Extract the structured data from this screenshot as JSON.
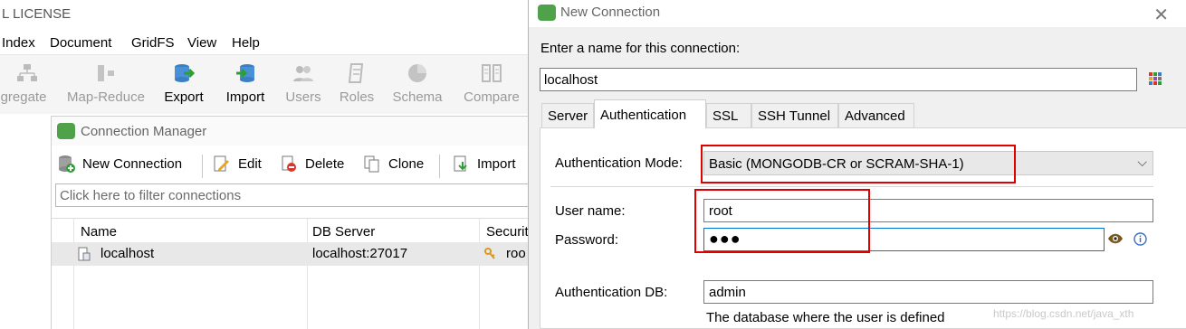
{
  "main_window": {
    "title": "L LICENSE",
    "menu": [
      "Index",
      "Document",
      "GridFS",
      "View",
      "Help"
    ],
    "toolbar": [
      {
        "label": "gregate",
        "icon": "aggregate-icon",
        "enabled": false
      },
      {
        "label": "Map-Reduce",
        "icon": "map-reduce-icon",
        "enabled": false
      },
      {
        "label": "Export",
        "icon": "export-icon",
        "enabled": true
      },
      {
        "label": "Import",
        "icon": "import-icon",
        "enabled": true
      },
      {
        "label": "Users",
        "icon": "users-icon",
        "enabled": false
      },
      {
        "label": "Roles",
        "icon": "roles-icon",
        "enabled": false
      },
      {
        "label": "Schema",
        "icon": "schema-icon",
        "enabled": false
      },
      {
        "label": "Compare",
        "icon": "compare-icon",
        "enabled": false
      }
    ]
  },
  "connection_manager": {
    "title": "Connection Manager",
    "toolbar": {
      "new_connection": "New Connection",
      "edit": "Edit",
      "delete": "Delete",
      "clone": "Clone",
      "import": "Import"
    },
    "filter_placeholder": "Click here to filter connections",
    "columns": [
      "Name",
      "DB Server",
      "Securit"
    ],
    "rows": [
      {
        "name": "localhost",
        "server": "localhost:27017",
        "security": "roo"
      }
    ]
  },
  "new_connection": {
    "title": "New Connection",
    "name_prompt": "Enter a name for this connection:",
    "name_value": "localhost",
    "tabs": [
      "Server",
      "Authentication",
      "SSL",
      "SSH Tunnel",
      "Advanced"
    ],
    "active_tab": "Authentication",
    "auth_mode_label": "Authentication Mode:",
    "auth_mode_value": "Basic (MONGODB-CR or SCRAM-SHA-1)",
    "username_label": "User name:",
    "username_value": "root",
    "password_label": "Password:",
    "password_value": "●●●",
    "auth_db_label": "Authentication DB:",
    "auth_db_value": "admin",
    "auth_db_hint": "The database where the user is defined"
  },
  "watermark": "https://blog.csdn.net/java_xth",
  "colors": {
    "highlight_red": "#e00000",
    "focus_blue": "#0078d7",
    "mongo_green": "#4fa14a"
  }
}
